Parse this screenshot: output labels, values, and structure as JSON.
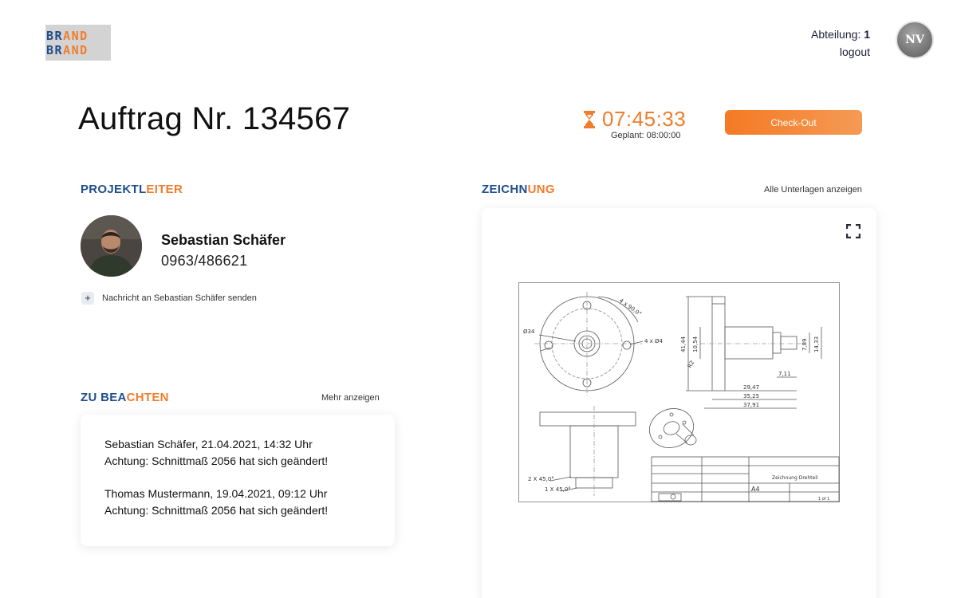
{
  "header": {
    "logo_line1_a": "BR",
    "logo_line1_b": "AND",
    "logo_line2_a": "BR",
    "logo_line2_b": "AND",
    "department_label": "Abteilung:",
    "department_value": "1",
    "logout_label": "logout",
    "avatar_initials": "NV"
  },
  "order": {
    "title": "Auftrag Nr. 134567",
    "timer_icon": "hourglass-icon",
    "elapsed": "07:45:33",
    "planned": "Geplant: 08:00:00",
    "checkout_label": "Check-Out"
  },
  "project_lead": {
    "title_a": "PROJEKTL",
    "title_b": "EITER",
    "name": "Sebastian Schäfer",
    "phone": "0963/486621",
    "message_label": "Nachricht an Sebastian Schäfer senden"
  },
  "notes": {
    "title_a": "ZU BEA",
    "title_b": "CHTEN",
    "more_label": "Mehr anzeigen",
    "items": [
      {
        "header": "Sebastian Schäfer, 21.04.2021, 14:32 Uhr",
        "text": "Achtung: Schnittmaß 2056 hat sich geändert!"
      },
      {
        "header": "Thomas Mustermann, 19.04.2021, 09:12 Uhr",
        "text": "Achtung: Schnittmaß 2056 hat sich geändert!"
      }
    ]
  },
  "drawing": {
    "title_a": "ZEICHN",
    "title_b": "UNG",
    "all_docs_label": "Alle Unterlagen anzeigen",
    "dims": {
      "d34": "Ø34",
      "holes": "4 x Ø4",
      "angle": "4 x 90,0°",
      "h4144": "41,44",
      "h1054": "10,54",
      "r2": "R2",
      "h789": "7,89",
      "h1433": "14,33",
      "w711": "7,11",
      "w2947": "29,47",
      "w3525": "35,25",
      "w3791": "37,91",
      "ch1": "2 X 45,0°",
      "ch2": "1 X 45,0°"
    },
    "title_block_name": "Zeichnung Drehteil",
    "size": "A4",
    "sheet": "1 of 1"
  },
  "colors": {
    "brand_blue": "#1f4e8c",
    "brand_orange": "#ef7d2e"
  }
}
